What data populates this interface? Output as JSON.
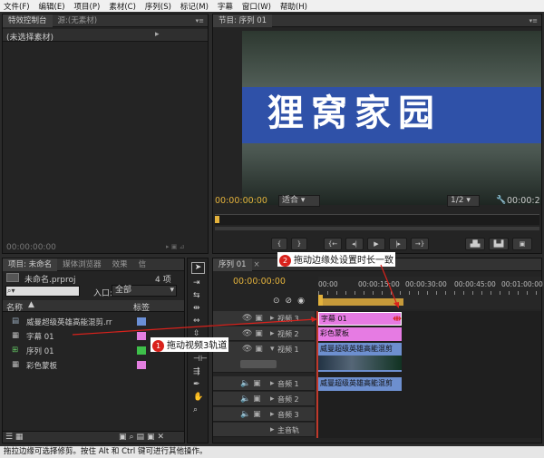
{
  "menu": [
    "文件(F)",
    "编辑(E)",
    "项目(P)",
    "素材(C)",
    "序列(S)",
    "标记(M)",
    "字幕",
    "窗口(W)",
    "帮助(H)"
  ],
  "left_top": {
    "tab1": "特效控制台",
    "tab2": "源:(无素材)",
    "nosel": "(未选择素材)",
    "time": "00:00:00:00"
  },
  "program": {
    "tab": "节目: 序列 01",
    "title_text": "狸窝家园",
    "timecode": "00:00:00:00",
    "fit": "适合",
    "ratio": "1/2",
    "end_time": "00:00:2"
  },
  "project": {
    "tab1": "项目: 未命名",
    "tab2": "媒体浏览器",
    "tab3": "效果",
    "tab4": "信",
    "file": "未命名.prproj",
    "count": "4 项",
    "search_placeholder": "",
    "entry_label": "入口:",
    "entry_value": "全部",
    "col_name": "名称",
    "col_label": "标签",
    "items": [
      {
        "name": "威曼超级英雄高能混剪.rr",
        "color": "#6a8fd6"
      },
      {
        "name": "字幕 01",
        "color": "#e37fe0"
      },
      {
        "name": "序列 01",
        "color": "#3ec04a"
      },
      {
        "name": "彩色蒙板",
        "color": "#e37fe0"
      }
    ]
  },
  "timeline": {
    "tab": "序列 01",
    "timecode": "00:00:00:00",
    "ruler": [
      "00:00",
      "00:00:15:00",
      "00:00:30:00",
      "00:00:45:00",
      "00:01:00:00"
    ],
    "tracks": [
      "视频 3",
      "视频 2",
      "视频 1",
      "音频 1",
      "音频 2",
      "音频 3",
      "主音轨"
    ],
    "clip_v3": "字幕 01",
    "clip_v2": "彩色蒙板",
    "clip_v1": "威曼超级英雄高能混剪",
    "clip_a1": "威曼超级英雄高能混剪"
  },
  "annotations": {
    "a1_num": "1",
    "a1": "拖动视频3轨道",
    "a2_num": "2",
    "a2": "拖动边缘处设置时长一致"
  },
  "status": "拖拉边缘可选择修剪。按住 Alt 和 Ctrl 键可进行其他操作。"
}
